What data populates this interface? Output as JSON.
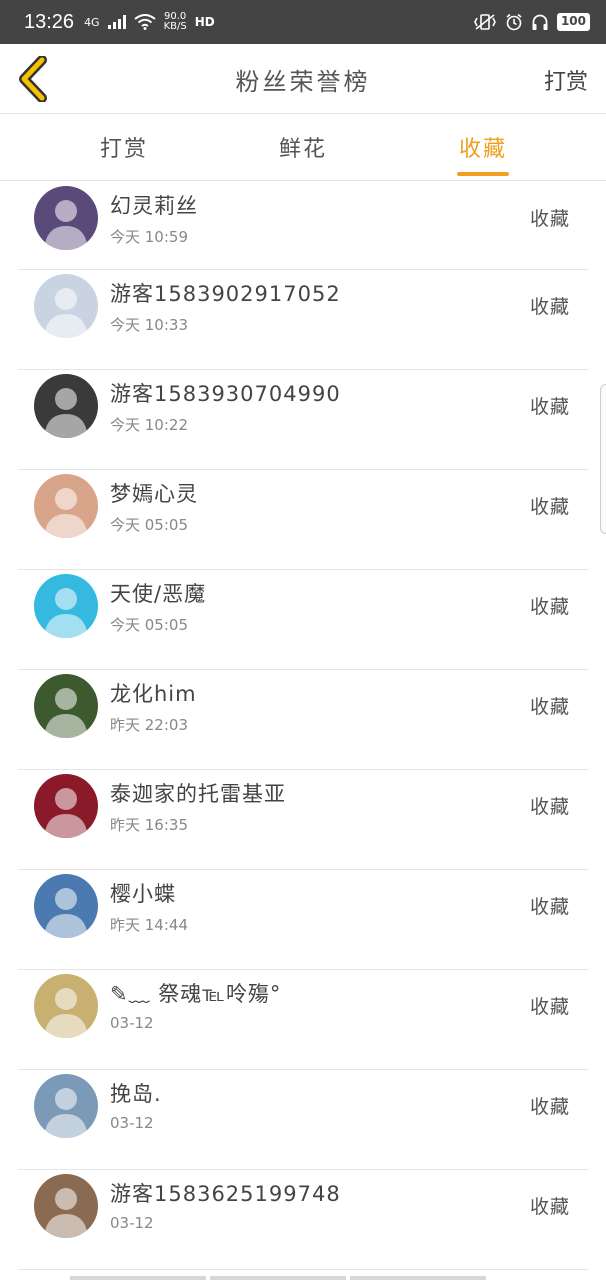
{
  "status_bar": {
    "time": "13:26",
    "network": "4G",
    "speed_value": "90.0",
    "speed_unit": "KB/S",
    "hd": "HD",
    "battery": "100"
  },
  "header": {
    "title": "粉丝荣誉榜",
    "action": "打赏"
  },
  "tabs": [
    {
      "label": "打赏",
      "active": false
    },
    {
      "label": "鲜花",
      "active": false
    },
    {
      "label": "收藏",
      "active": true
    }
  ],
  "list": [
    {
      "name": "幻灵莉丝",
      "time": "今天 10:59",
      "action": "收藏",
      "avatar_color": "#5a4a7a"
    },
    {
      "name": "游客1583902917052",
      "time": "今天 10:33",
      "action": "收藏",
      "avatar_color": "#c9d3e2"
    },
    {
      "name": "游客1583930704990",
      "time": "今天 10:22",
      "action": "收藏",
      "avatar_color": "#3a3a3a"
    },
    {
      "name": "梦嫣心灵",
      "time": "今天 05:05",
      "action": "收藏",
      "avatar_color": "#d9a58a"
    },
    {
      "name": "天使/恶魔",
      "time": "今天 05:05",
      "action": "收藏",
      "avatar_color": "#35b9e0"
    },
    {
      "name": "龙化him",
      "time": "昨天 22:03",
      "action": "收藏",
      "avatar_color": "#3d5a2e"
    },
    {
      "name": "泰迦家的托雷基亚",
      "time": "昨天 16:35",
      "action": "收藏",
      "avatar_color": "#8a1a2a"
    },
    {
      "name": "樱小蝶",
      "time": "昨天 14:44",
      "action": "收藏",
      "avatar_color": "#4a7ab0"
    },
    {
      "name": "✎﹏ 祭魂℡呤殤°",
      "time": "03-12",
      "action": "收藏",
      "avatar_color": "#c8b070"
    },
    {
      "name": "挽岛.",
      "time": "03-12",
      "action": "收藏",
      "avatar_color": "#7a9ab8"
    },
    {
      "name": "游客1583625199748",
      "time": "03-12",
      "action": "收藏",
      "avatar_color": "#8a6a50"
    }
  ]
}
